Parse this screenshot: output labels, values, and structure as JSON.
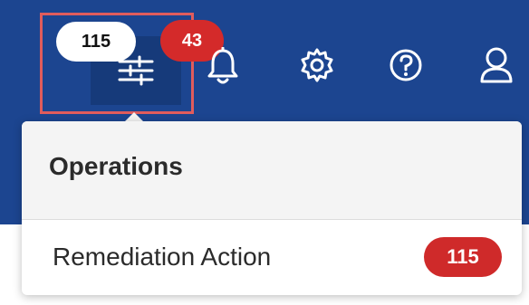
{
  "topbar": {
    "operations_button": {
      "count": "115",
      "icon": "sliders-icon",
      "alert_count": "43"
    },
    "notifications_icon": "bell-icon",
    "settings_icon": "gear-icon",
    "help_icon": "help-icon",
    "user_icon": "user-icon",
    "colors": {
      "bar": "#1c4590",
      "badge_red": "#d42a2a",
      "highlight": "#e05c5c"
    }
  },
  "dropdown": {
    "title": "Operations",
    "items": [
      {
        "label": "Remediation Action",
        "count": "115"
      }
    ]
  }
}
